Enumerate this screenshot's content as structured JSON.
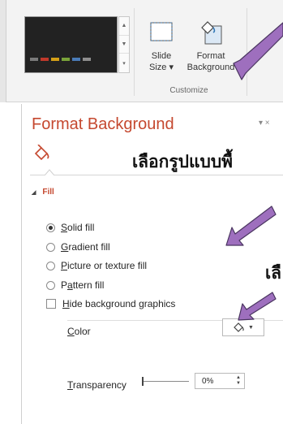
{
  "ribbon": {
    "slide_size": {
      "line1": "Slide",
      "line2": "Size ▾"
    },
    "format_background": {
      "line1": "Format",
      "line2": "Background"
    },
    "group_label": "Customize"
  },
  "pane": {
    "title": "Format Background",
    "controls": "▾ ×",
    "section": "Fill",
    "options": {
      "solid": {
        "key": "S",
        "rest": "olid fill",
        "selected": true
      },
      "gradient": {
        "key": "G",
        "rest": "radient fill"
      },
      "picture": {
        "key": "P",
        "rest": "icture or texture fill"
      },
      "pattern_pre": "P",
      "pattern_key": "a",
      "pattern_rest": "ttern fill",
      "hide_key": "H",
      "hide_rest": "ide background graphics"
    },
    "color": {
      "key": "C",
      "rest": "olor"
    },
    "transparency": {
      "key": "T",
      "rest": "ransparency",
      "value": "0%",
      "percent": 0
    }
  },
  "annotations": {
    "text1": "เลือกรูปแบบพื้",
    "text2": "เลื"
  },
  "colors": {
    "accent": "#c5482f",
    "annotation_arrow": "#9e6fbe"
  }
}
